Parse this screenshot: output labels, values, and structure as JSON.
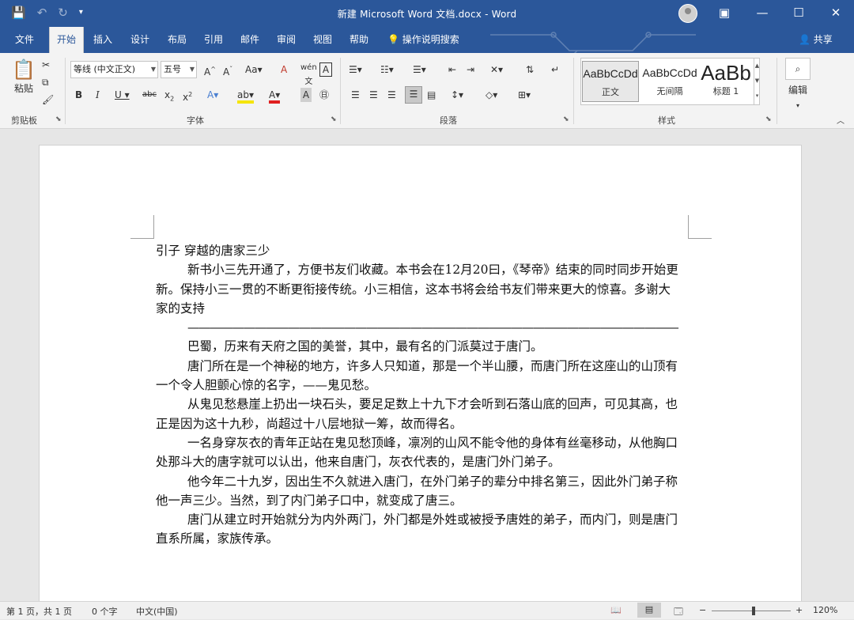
{
  "window": {
    "title": "新建 Microsoft Word 文档.docx  -  Word"
  },
  "tabs": [
    {
      "label": "文件"
    },
    {
      "label": "开始"
    },
    {
      "label": "插入"
    },
    {
      "label": "设计"
    },
    {
      "label": "布局"
    },
    {
      "label": "引用"
    },
    {
      "label": "邮件"
    },
    {
      "label": "审阅"
    },
    {
      "label": "视图"
    },
    {
      "label": "帮助"
    }
  ],
  "tellme": "操作说明搜索",
  "share": "共享",
  "clipboard": {
    "paste": "粘贴",
    "group": "剪贴板"
  },
  "font": {
    "name": "等线 (中文正文)",
    "size": "五号",
    "group": "字体"
  },
  "paragraph": {
    "group": "段落"
  },
  "styles": {
    "group": "样式",
    "items": [
      {
        "sample": "AaBbCcDd",
        "name": "正文"
      },
      {
        "sample": "AaBbCcDd",
        "name": "无间隔"
      },
      {
        "sample": "AaBb",
        "name": "标题 1"
      }
    ]
  },
  "editing": {
    "label": "编辑"
  },
  "document": {
    "heading": "引子  穿越的唐家三少",
    "paragraphs": [
      "新书小三先开通了，方便书友们收藏。本书会在12月20曰，《琴帝》结束的同时同步开始更新。保持小三一贯的不断更衔接传统。小三相信，这本书将会给书友们带来更大的惊喜。多谢大家的支持",
      "————————————————————————————————————————————",
      "巴蜀，历来有天府之国的美誉，其中，最有名的门派莫过于唐门。",
      "唐门所在是一个神秘的地方，许多人只知道，那是一个半山腰，而唐门所在这座山的山顶有一个令人胆颤心惊的名字，——鬼见愁。",
      "从鬼见愁悬崖上扔出一块石头，要足足数上十九下才会听到石落山底的回声，可见其高，也正是因为这十九秒，尚超过十八层地狱一筹，故而得名。",
      "一名身穿灰衣的青年正站在鬼见愁顶峰，凛冽的山风不能令他的身体有丝毫移动，从他胸口处那斗大的唐字就可以认出，他来自唐门，灰衣代表的，是唐门外门弟子。",
      "他今年二十九岁，因出生不久就进入唐门，在外门弟子的辈分中排名第三，因此外门弟子称他一声三少。当然，到了内门弟子口中，就变成了唐三。",
      "唐门从建立时开始就分为内外两门，外门都是外姓或被授予唐姓的弟子，而内门，则是唐门直系所属，家族传承。"
    ]
  },
  "status": {
    "page": "第 1 页，共 1 页",
    "words": "0 个字",
    "lang": "中文(中国)",
    "zoom": "120%"
  },
  "colors": {
    "accent": "#2b579a",
    "ribbon": "#f3f3f3"
  }
}
